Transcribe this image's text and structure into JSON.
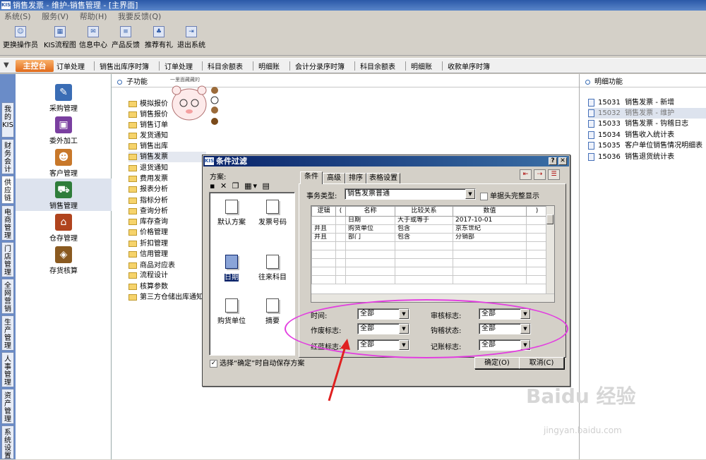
{
  "window": {
    "title": "销售发票 - 维护-销售管理 - [主界面]",
    "logo": "KIS"
  },
  "menu": [
    "系统(S)",
    "服务(V)",
    "帮助(H)",
    "我要反馈(Q)"
  ],
  "toolbar": [
    {
      "label": "更换操作员",
      "icon": "users-icon"
    },
    {
      "label": "KIS流程图",
      "icon": "flowchart-icon"
    },
    {
      "label": "信息中心",
      "icon": "message-icon"
    },
    {
      "label": "产品反馈",
      "icon": "feedback-icon"
    },
    {
      "label": "推荐有礼",
      "icon": "gift-icon"
    },
    {
      "label": "退出系统",
      "icon": "exit-icon"
    }
  ],
  "tabs": {
    "home": "主控台",
    "items": [
      "订单处理",
      "销售出库序时簿",
      "订单处理",
      "科目余额表",
      "明细账",
      "会计分录序时簿",
      "科目余额表",
      "明细账",
      "收款单序时簿"
    ]
  },
  "sidetabs": [
    "我的KIS",
    "财务会计",
    "供应链",
    "电商管理",
    "门店管理",
    "全网营销",
    "生产管理",
    "人事管理",
    "资产管理",
    "系统设置"
  ],
  "modules": [
    {
      "label": "采购管理",
      "icon": "purchase-icon",
      "color": "#3a6db5"
    },
    {
      "label": "委外加工",
      "icon": "outsource-icon",
      "color": "#7a3fa0"
    },
    {
      "label": "客户管理",
      "icon": "customer-icon",
      "color": "#c8782a"
    },
    {
      "label": "销售管理",
      "icon": "sales-icon",
      "color": "#2f7d3a"
    },
    {
      "label": "仓存管理",
      "icon": "warehouse-icon",
      "color": "#b0441e"
    },
    {
      "label": "存货核算",
      "icon": "inventory-icon",
      "color": "#8a5a20"
    }
  ],
  "sub": {
    "header": "子功能",
    "items": [
      "模拟报价",
      "销售报价",
      "销售订单",
      "发货通知",
      "销售出库",
      "销售发票",
      "退货通知",
      "费用发票",
      "报表分析",
      "指标分析",
      "查询分析",
      "库存查询",
      "价格管理",
      "折扣管理",
      "信用管理",
      "商品对应表",
      "流程设计",
      "核算参数",
      "第三方仓储出库通知"
    ],
    "selected_index": 5
  },
  "detail": {
    "header": "明细功能",
    "items": [
      {
        "code": "15031",
        "label": "销售发票 - 新增"
      },
      {
        "code": "15032",
        "label": "销售发票 - 维护"
      },
      {
        "code": "15033",
        "label": "销售发票 - 钩稽日志"
      },
      {
        "code": "15034",
        "label": "销售收入统计表"
      },
      {
        "code": "15035",
        "label": "客户单位销售情况明细表"
      },
      {
        "code": "15036",
        "label": "销售退货统计表"
      }
    ],
    "selected_index": 1
  },
  "sticker_text": "一里面藏藏的",
  "watermark": {
    "brand": "Baidu 经验",
    "url": "jingyan.baidu.com"
  },
  "dialog": {
    "title": "条件过滤",
    "scheme_label": "方案:",
    "schemes": [
      "默认方案",
      "发票号码",
      "日期",
      "往来科目",
      "购货单位",
      "摘要"
    ],
    "selected_scheme": 2,
    "tabs": [
      "条件",
      "高级",
      "排序",
      "表格设置"
    ],
    "business_type_label": "事务类型:",
    "business_type_value": "销售发票普通",
    "full_header_label": "单据头完整显示",
    "grid_headers": [
      "逻辑",
      "(",
      "名称",
      "比较关系",
      "数值",
      ")"
    ],
    "grid_rows": [
      [
        "",
        "",
        "日期",
        "大于或等于",
        "2017-10-01",
        ""
      ],
      [
        "并且",
        "",
        "购货单位",
        "包含",
        "京东世纪",
        ""
      ],
      [
        "并且",
        "",
        "部门",
        "包含",
        "分销部",
        ""
      ]
    ],
    "filters": [
      {
        "label": "时间:",
        "value": "全部"
      },
      {
        "label": "审核标志:",
        "value": "全部"
      },
      {
        "label": "作废标志:",
        "value": "全部"
      },
      {
        "label": "钩稽状态:",
        "value": "全部"
      },
      {
        "label": "红蓝标志:",
        "value": "全部"
      },
      {
        "label": "记账标志:",
        "value": "全部"
      }
    ],
    "autosave_label": "选择“确定”时自动保存方案",
    "ok_label": "确定(O)",
    "cancel_label": "取消(C)"
  }
}
